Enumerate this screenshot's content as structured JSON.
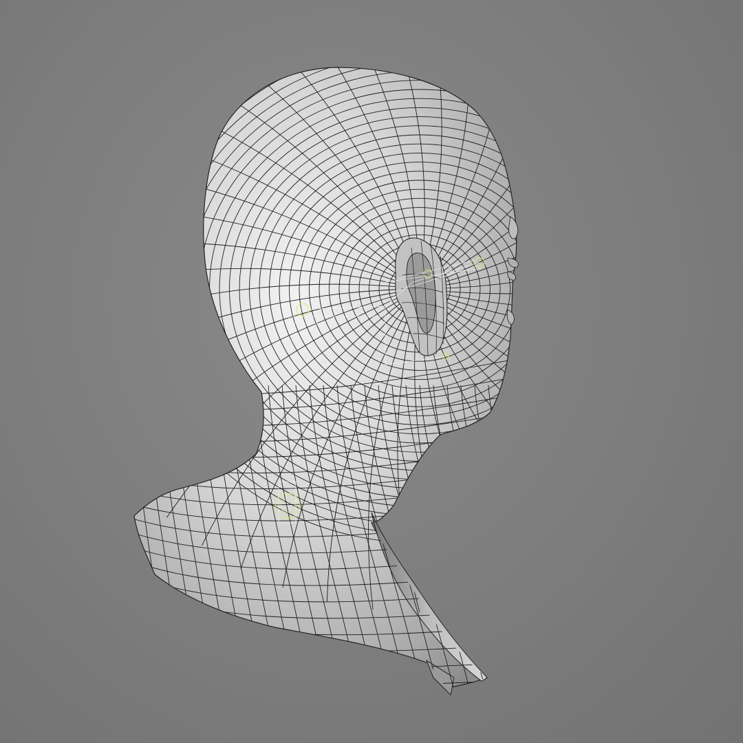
{
  "viewport": {
    "background_color": "#7b7b7b",
    "mesh_fill_color": "#cfcfcf",
    "wire_color": "#1a1a1a",
    "rig_helper_color": "#d6e85a",
    "subject": "wireframe-head-bust"
  }
}
